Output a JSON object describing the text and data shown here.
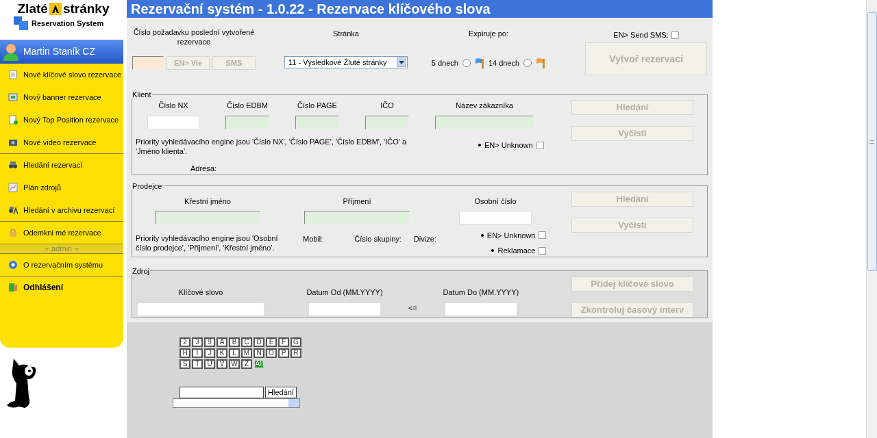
{
  "logo": {
    "brand_left": "Zlaté",
    "brand_right": "stránky",
    "subtitle": "Reservation System"
  },
  "user": {
    "name": "Martin Staník CZ"
  },
  "sidebar": {
    "groups": [
      {
        "items": [
          {
            "label": "Nové klíčové slovo rezervace",
            "bold": false
          },
          {
            "label": "Nový banner rezervace",
            "bold": false
          },
          {
            "label": "Nový Top Position rezervace",
            "bold": false
          },
          {
            "label": "Nové video rezervace",
            "bold": false
          }
        ]
      },
      {
        "items": [
          {
            "label": "Hledání rezervací",
            "bold": false
          },
          {
            "label": "Plán zdrojů",
            "bold": false
          },
          {
            "label": "Hledání v archivu rezervací",
            "bold": false
          }
        ]
      },
      {
        "items": [
          {
            "label": "Odemkni mé rezervace",
            "bold": false
          }
        ]
      },
      {
        "heading": "admin",
        "items": [
          {
            "label": "O rezervačním systému",
            "bold": false
          }
        ]
      },
      {
        "items": [
          {
            "label": "Odhlášení",
            "bold": true
          }
        ]
      }
    ]
  },
  "title": "Rezervační systém - 1.0.22 - Rezervace klíčového slova",
  "top": {
    "request_label": "Číslo požadavku poslední vytvořené rezervace",
    "view_button": {
      "label": "EN> Vie",
      "disabled": true
    },
    "sms_button": {
      "label": "SMS",
      "disabled": true
    },
    "page_label": "Stránka",
    "page_select": "11 - Výsledkové Žluté stránky",
    "expire_label": "Expiruje po:",
    "expire_options": [
      {
        "label": "5 dnech",
        "selected": false,
        "color": "#4a90e2"
      },
      {
        "label": "14 dnech",
        "selected": false,
        "color": "#f0a040"
      }
    ],
    "send_sms": {
      "label": "EN> Send SMS:",
      "checked": false
    },
    "create_button": {
      "label": "Vytvoř rezervaci",
      "disabled": true
    }
  },
  "client": {
    "legend": "Klient",
    "fields": [
      {
        "label": "Číslo NX",
        "highlighted": false
      },
      {
        "label": "Číslo EDBM",
        "highlighted": true
      },
      {
        "label": "Číslo PAGE",
        "highlighted": true
      },
      {
        "label": "IČO",
        "highlighted": true
      },
      {
        "label": "Název zákazníka",
        "highlighted": true
      }
    ],
    "hint": "Priority vyhledávacího engine jsou 'Číslo NX', 'Číslo PAGE', 'Číslo EDBM', 'IČO' a 'Jméno klienta'.",
    "checkboxes": [
      {
        "label": "EN> Unknown",
        "checked": false
      }
    ],
    "address_label": "Adresa:",
    "buttons": [
      {
        "label": "Hledání",
        "disabled": true
      },
      {
        "label": "Vyčisti",
        "disabled": true
      }
    ]
  },
  "seller": {
    "legend": "Prodejce",
    "fields": [
      {
        "label": "Křestní jméno",
        "highlighted": true
      },
      {
        "label": "Příjmení",
        "highlighted": true
      },
      {
        "label": "Osobní číslo",
        "highlighted": false
      }
    ],
    "hint": "Priority vyhledávacího engine jsou 'Osobní číslo prodejce', 'Příjmení', 'Křestní jméno'.",
    "info_labels": [
      "Mobil:",
      "Číslo skupiny:",
      "Divize:"
    ],
    "checkboxes": [
      {
        "label": "EN> Unknown",
        "checked": false
      },
      {
        "label": "Reklamace",
        "checked": false
      }
    ],
    "buttons": [
      {
        "label": "Hledání",
        "disabled": true
      },
      {
        "label": "Vyčisti",
        "disabled": true
      }
    ]
  },
  "source": {
    "legend": "Zdroj",
    "keyword_label": "Klíčové slovo",
    "date_from_label": "Datum Od (MM.YYYY)",
    "relation": "<=",
    "date_to_label": "Datum Do (MM.YYYY)",
    "buttons": [
      {
        "label": "Přidej klíčové slovo",
        "disabled": true
      },
      {
        "label": "Zkontroluj časový interv",
        "disabled": true
      }
    ]
  },
  "letters": [
    {
      "label": "2",
      "selected": false
    },
    {
      "label": "3",
      "selected": false
    },
    {
      "label": "9",
      "selected": false
    },
    {
      "label": "A",
      "selected": false
    },
    {
      "label": "B",
      "selected": false
    },
    {
      "label": "C",
      "selected": false
    },
    {
      "label": "D",
      "selected": false
    },
    {
      "label": "E",
      "selected": false
    },
    {
      "label": "F",
      "selected": false
    },
    {
      "label": "G",
      "selected": false
    },
    {
      "label": "H",
      "selected": false
    },
    {
      "label": "I",
      "selected": false
    },
    {
      "label": "J",
      "selected": false
    },
    {
      "label": "K",
      "selected": false
    },
    {
      "label": "L",
      "selected": false
    },
    {
      "label": "M",
      "selected": false
    },
    {
      "label": "N",
      "selected": false
    },
    {
      "label": "O",
      "selected": false
    },
    {
      "label": "P",
      "selected": false
    },
    {
      "label": "R",
      "selected": false
    },
    {
      "label": "S",
      "selected": false
    },
    {
      "label": "T",
      "selected": false
    },
    {
      "label": "U",
      "selected": false
    },
    {
      "label": "V",
      "selected": false
    },
    {
      "label": "W",
      "selected": false
    },
    {
      "label": "Z",
      "selected": false
    },
    {
      "label": "All",
      "selected": true
    }
  ],
  "bottom_search": {
    "button": "Hledání"
  }
}
